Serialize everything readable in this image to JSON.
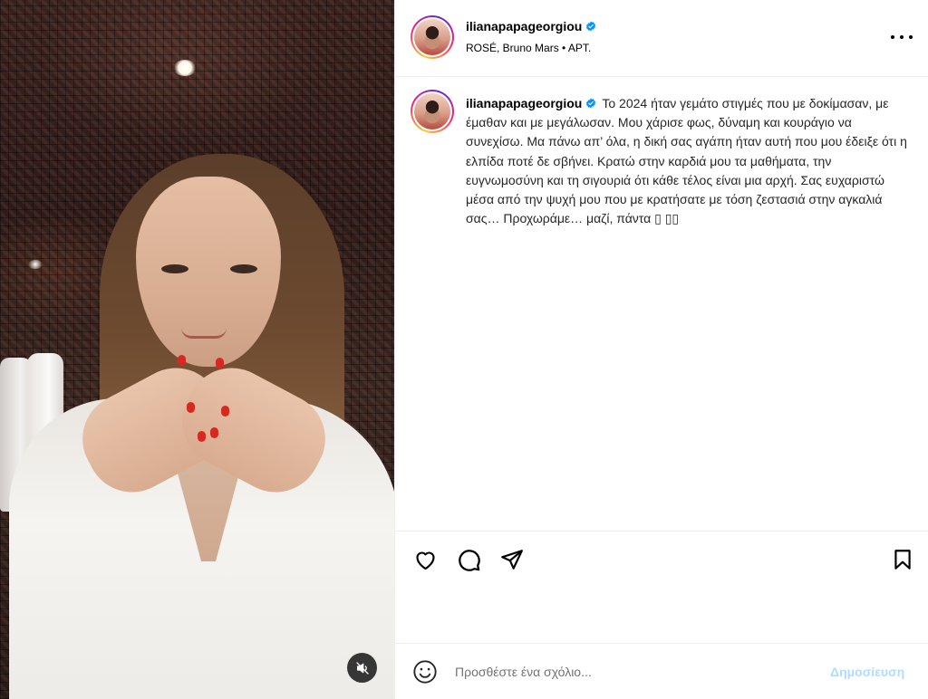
{
  "post": {
    "username": "ilianapapageorgiou",
    "verified": true,
    "audio": "ROSÉ, Bruno Mars • APT."
  },
  "caption": {
    "username": "ilianapapageorgiou",
    "text": "Το 2024 ήταν γεμάτο στιγμές που με δοκίμασαν, με έμαθαν και με μεγάλωσαν. Μου χάρισε φως, δύναμη και κουράγιο να συνεχίσω. Μα πάνω απ’ όλα, η δική σας αγάπη ήταν αυτή που μου έδειξε ότι η ελπίδα ποτέ δε σβήνει. Κρατώ στην καρδιά μου τα μαθήματα, την ευγνωμοσύνη και τη σιγουριά ότι κάθε τέλος είναι μια αρχή. Σας ευχαριστώ μέσα από την ψυχή μου που με κρατήσατε με τόση ζεστασιά στην αγκαλιά σας… Προχωράμε… μαζί, πάντα ▯ ▯▯"
  },
  "comment_box": {
    "placeholder": "Προσθέστε ένα σχόλιο...",
    "post_label": "Δημοσίευση"
  },
  "icons": {
    "verified": "verified-badge-icon",
    "more": "more-options-icon",
    "like": "heart-icon",
    "comment": "comment-bubble-icon",
    "share": "paper-plane-icon",
    "save": "bookmark-icon",
    "emoji": "emoji-smiley-icon",
    "mute": "speaker-muted-icon"
  },
  "colors": {
    "verified_blue": "#0095f6",
    "post_button_disabled": "#b3dbff",
    "placeholder_gray": "#737373",
    "divider": "#efefef"
  }
}
